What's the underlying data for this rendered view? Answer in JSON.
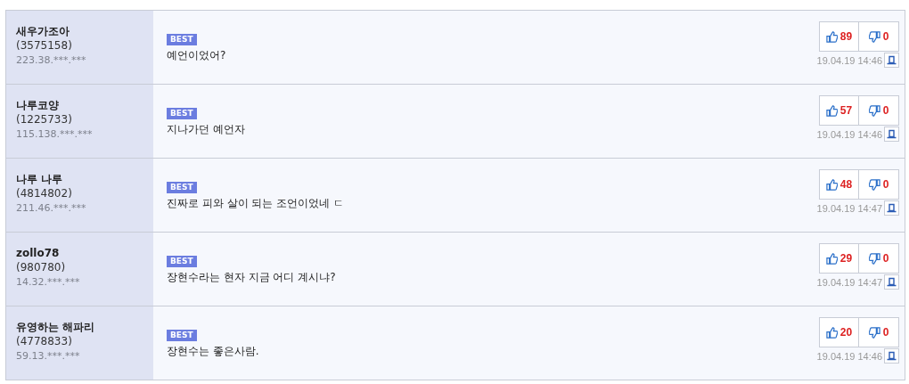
{
  "comments": [
    {
      "nickname": "새우가조아",
      "member_id": "(3575158)",
      "ip": "223.38.***.***",
      "badge": "BEST",
      "text": "예언이었어?",
      "likes": "89",
      "dislikes": "0",
      "time": "19.04.19 14:46"
    },
    {
      "nickname": "나루코양",
      "member_id": "(1225733)",
      "ip": "115.138.***.***",
      "badge": "BEST",
      "text": "지나가던 예언자",
      "likes": "57",
      "dislikes": "0",
      "time": "19.04.19 14:46"
    },
    {
      "nickname": "나루 나루",
      "member_id": "(4814802)",
      "ip": "211.46.***.***",
      "badge": "BEST",
      "text": "진짜로 피와 살이 되는 조언이었네 ㄷ",
      "likes": "48",
      "dislikes": "0",
      "time": "19.04.19 14:47"
    },
    {
      "nickname": "zollo78",
      "member_id": "(980780)",
      "ip": "14.32.***.***",
      "badge": "BEST",
      "text": "장현수라는 현자 지금 어디 계시냐?",
      "likes": "29",
      "dislikes": "0",
      "time": "19.04.19 14:47"
    },
    {
      "nickname": "유영하는 해파리",
      "member_id": "(4778833)",
      "ip": "59.13.***.***",
      "badge": "BEST",
      "text": "장현수는 좋은사람.",
      "likes": "20",
      "dislikes": "0",
      "time": "19.04.19 14:46"
    }
  ]
}
